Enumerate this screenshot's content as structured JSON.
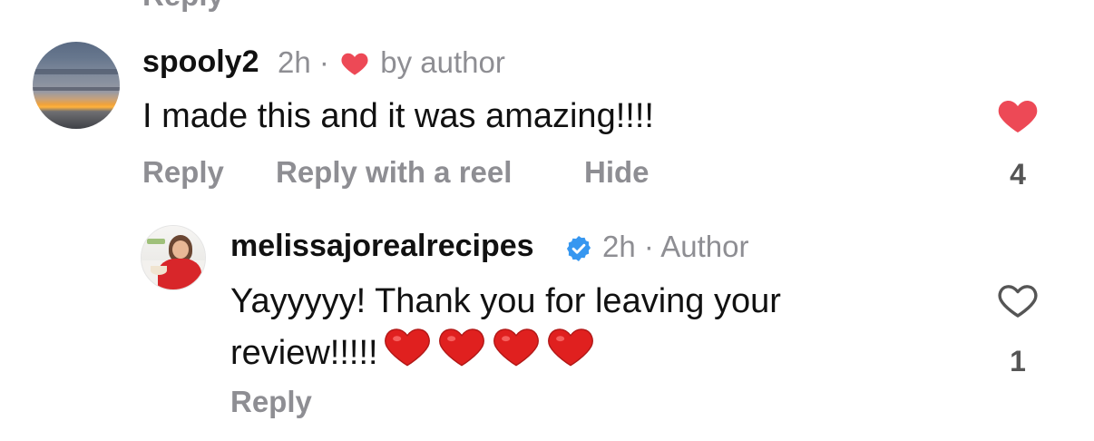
{
  "top": {
    "clipped_action": "Reply"
  },
  "comments": [
    {
      "username": "spooly2",
      "time": "2h",
      "separator": "·",
      "author_liked_label": "by author",
      "text": "I made this and it was amazing!!!!",
      "actions": {
        "reply": "Reply",
        "reply_with_reel": "Reply with a reel",
        "hide": "Hide"
      },
      "like": {
        "liked": true,
        "count": "4",
        "color": "#ed4956"
      }
    },
    {
      "username": "melissajorealrecipes",
      "verified": true,
      "time": "2h",
      "separator": "·",
      "author_label": "Author",
      "text_line1": "Yayyyyy! Thank you for leaving your",
      "text_line2": "review!!!!!",
      "emoji_hearts": 4,
      "actions": {
        "reply": "Reply"
      },
      "like": {
        "liked": false,
        "count": "1"
      }
    }
  ],
  "colors": {
    "secondary_text": "#8e8e93",
    "primary_text": "#111111",
    "heart_red": "#ed4956",
    "verified_blue": "#3797f0"
  }
}
